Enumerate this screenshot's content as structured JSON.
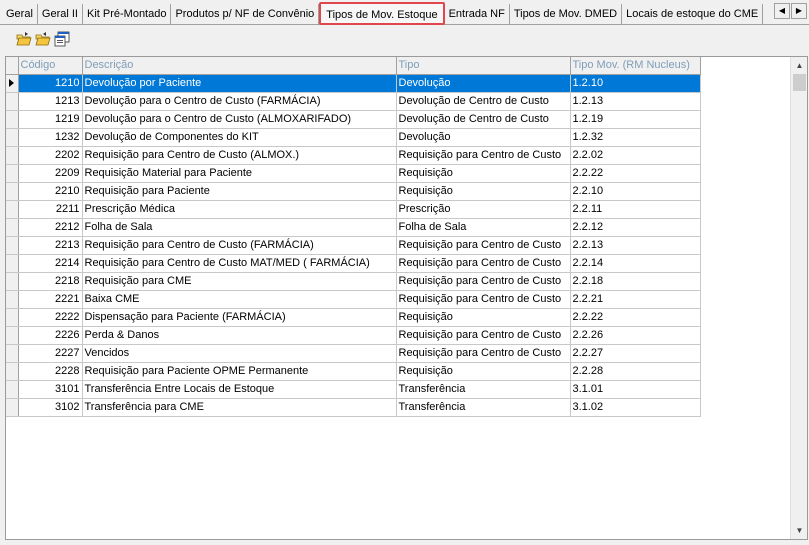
{
  "tabs": [
    {
      "label": "Geral"
    },
    {
      "label": "Geral II"
    },
    {
      "label": "Kit Pré-Montado"
    },
    {
      "label": "Produtos p/ NF de Convênio"
    },
    {
      "label": "Tipos de Mov. Estoque",
      "active": true
    },
    {
      "label": "Entrada NF"
    },
    {
      "label": "Tipos de Mov. DMED"
    },
    {
      "label": "Locais de estoque do CME"
    }
  ],
  "toolbar": {
    "icons": [
      "folder-open-icon",
      "folder-open-icon",
      "properties-icon"
    ]
  },
  "table": {
    "columns": [
      "Código",
      "Descrição",
      "Tipo",
      "Tipo Mov. (RM Nucleus)"
    ],
    "selected_row": 0,
    "rows": [
      [
        "1210",
        "Devolução por Paciente",
        "Devolução",
        "1.2.10"
      ],
      [
        "1213",
        "Devolução para o Centro de Custo (FARMÁCIA)",
        "Devolução de Centro de Custo",
        "1.2.13"
      ],
      [
        "1219",
        "Devolução para o Centro de Custo (ALMOXARIFADO)",
        "Devolução de Centro de Custo",
        "1.2.19"
      ],
      [
        "1232",
        "Devolução de Componentes do KIT",
        "Devolução",
        "1.2.32"
      ],
      [
        "2202",
        "Requisição para Centro de Custo (ALMOX.)",
        "Requisição para Centro de Custo",
        "2.2.02"
      ],
      [
        "2209",
        "Requisição Material para Paciente",
        "Requisição",
        "2.2.22"
      ],
      [
        "2210",
        "Requisição para Paciente",
        "Requisição",
        "2.2.10"
      ],
      [
        "2211",
        "Prescrição Médica",
        "Prescrição",
        "2.2.11"
      ],
      [
        "2212",
        "Folha de Sala",
        "Folha de Sala",
        "2.2.12"
      ],
      [
        "2213",
        "Requisição para Centro de Custo (FARMÁCIA)",
        "Requisição para Centro de Custo",
        "2.2.13"
      ],
      [
        "2214",
        "Requisição para Centro de Custo MAT/MED ( FARMÁCIA)",
        "Requisição para Centro de Custo",
        "2.2.14"
      ],
      [
        "2218",
        "Requisição para CME",
        "Requisição para Centro de Custo",
        "2.2.18"
      ],
      [
        "2221",
        "Baixa CME",
        "Requisição para Centro de Custo",
        "2.2.21"
      ],
      [
        "2222",
        "Dispensação para Paciente (FARMÁCIA)",
        "Requisição",
        "2.2.22"
      ],
      [
        "2226",
        "Perda & Danos",
        "Requisição para Centro de Custo",
        "2.2.26"
      ],
      [
        "2227",
        "Vencidos",
        "Requisição para Centro de Custo",
        "2.2.27"
      ],
      [
        "2228",
        "Requisição para Paciente OPME Permanente",
        "Requisição",
        "2.2.28"
      ],
      [
        "3101",
        "Transferência Entre Locais de Estoque",
        "Transferência",
        "3.1.01"
      ],
      [
        "3102",
        "Transferência para CME",
        "Transferência",
        "3.1.02"
      ]
    ]
  },
  "colors": {
    "selection": "#0078d7",
    "active_tab_border": "#e0474c",
    "header_text": "#7f9db9"
  }
}
